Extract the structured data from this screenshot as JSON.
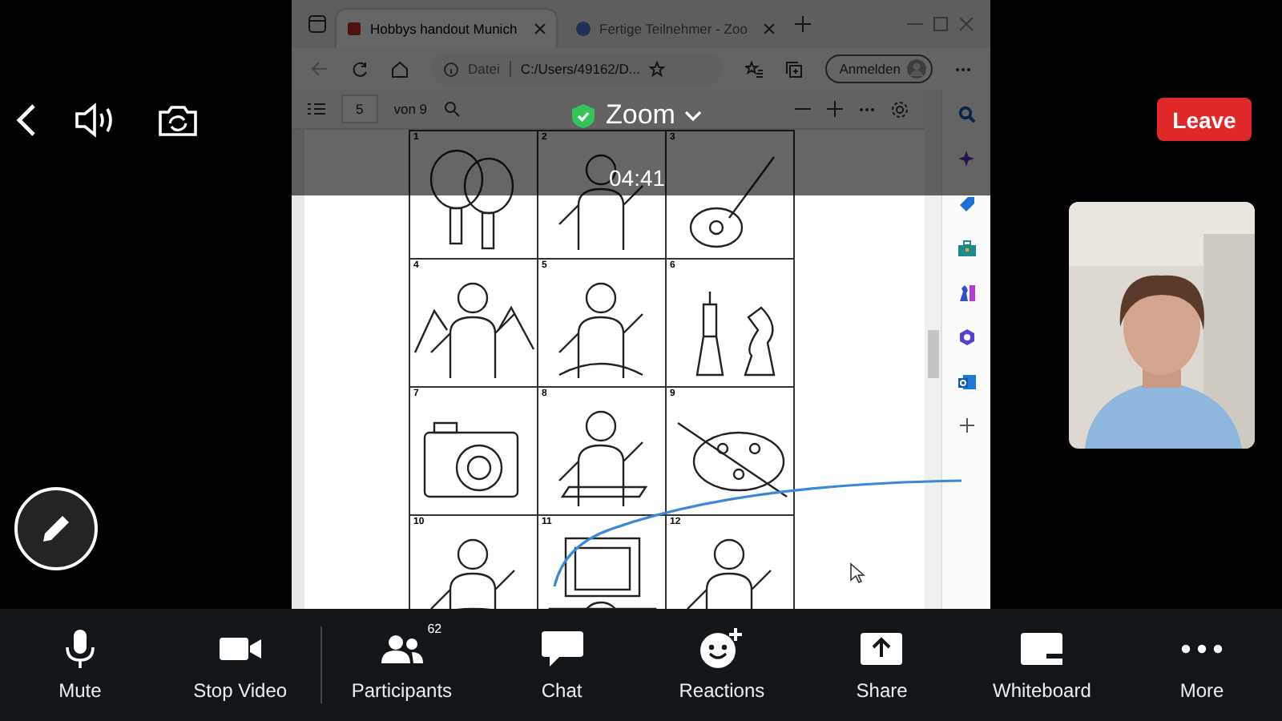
{
  "browser": {
    "tabs": [
      {
        "title": "Hobbys handout Munich",
        "selected": true
      },
      {
        "title": "Fertige Teilnehmer - Zoo",
        "selected": false
      }
    ],
    "address": {
      "scheme": "Datei",
      "url": "C:/Users/49162/D..."
    },
    "sign_in": "Anmelden"
  },
  "pdf": {
    "page": "5",
    "page_count": "von 9",
    "cells": [
      "1",
      "2",
      "3",
      "4",
      "5",
      "6",
      "7",
      "8",
      "9",
      "10",
      "11",
      "12"
    ]
  },
  "meeting": {
    "title": "Zoom",
    "timer": "04:41",
    "leave": "Leave"
  },
  "toolbar": [
    {
      "label": "Mute",
      "kind": "mic"
    },
    {
      "label": "Stop Video",
      "kind": "video"
    },
    {
      "label": "Participants",
      "kind": "people",
      "badge": "62"
    },
    {
      "label": "Chat",
      "kind": "chat"
    },
    {
      "label": "Reactions",
      "kind": "reactions"
    },
    {
      "label": "Share",
      "kind": "share"
    },
    {
      "label": "Whiteboard",
      "kind": "whiteboard"
    },
    {
      "label": "More",
      "kind": "more"
    }
  ]
}
